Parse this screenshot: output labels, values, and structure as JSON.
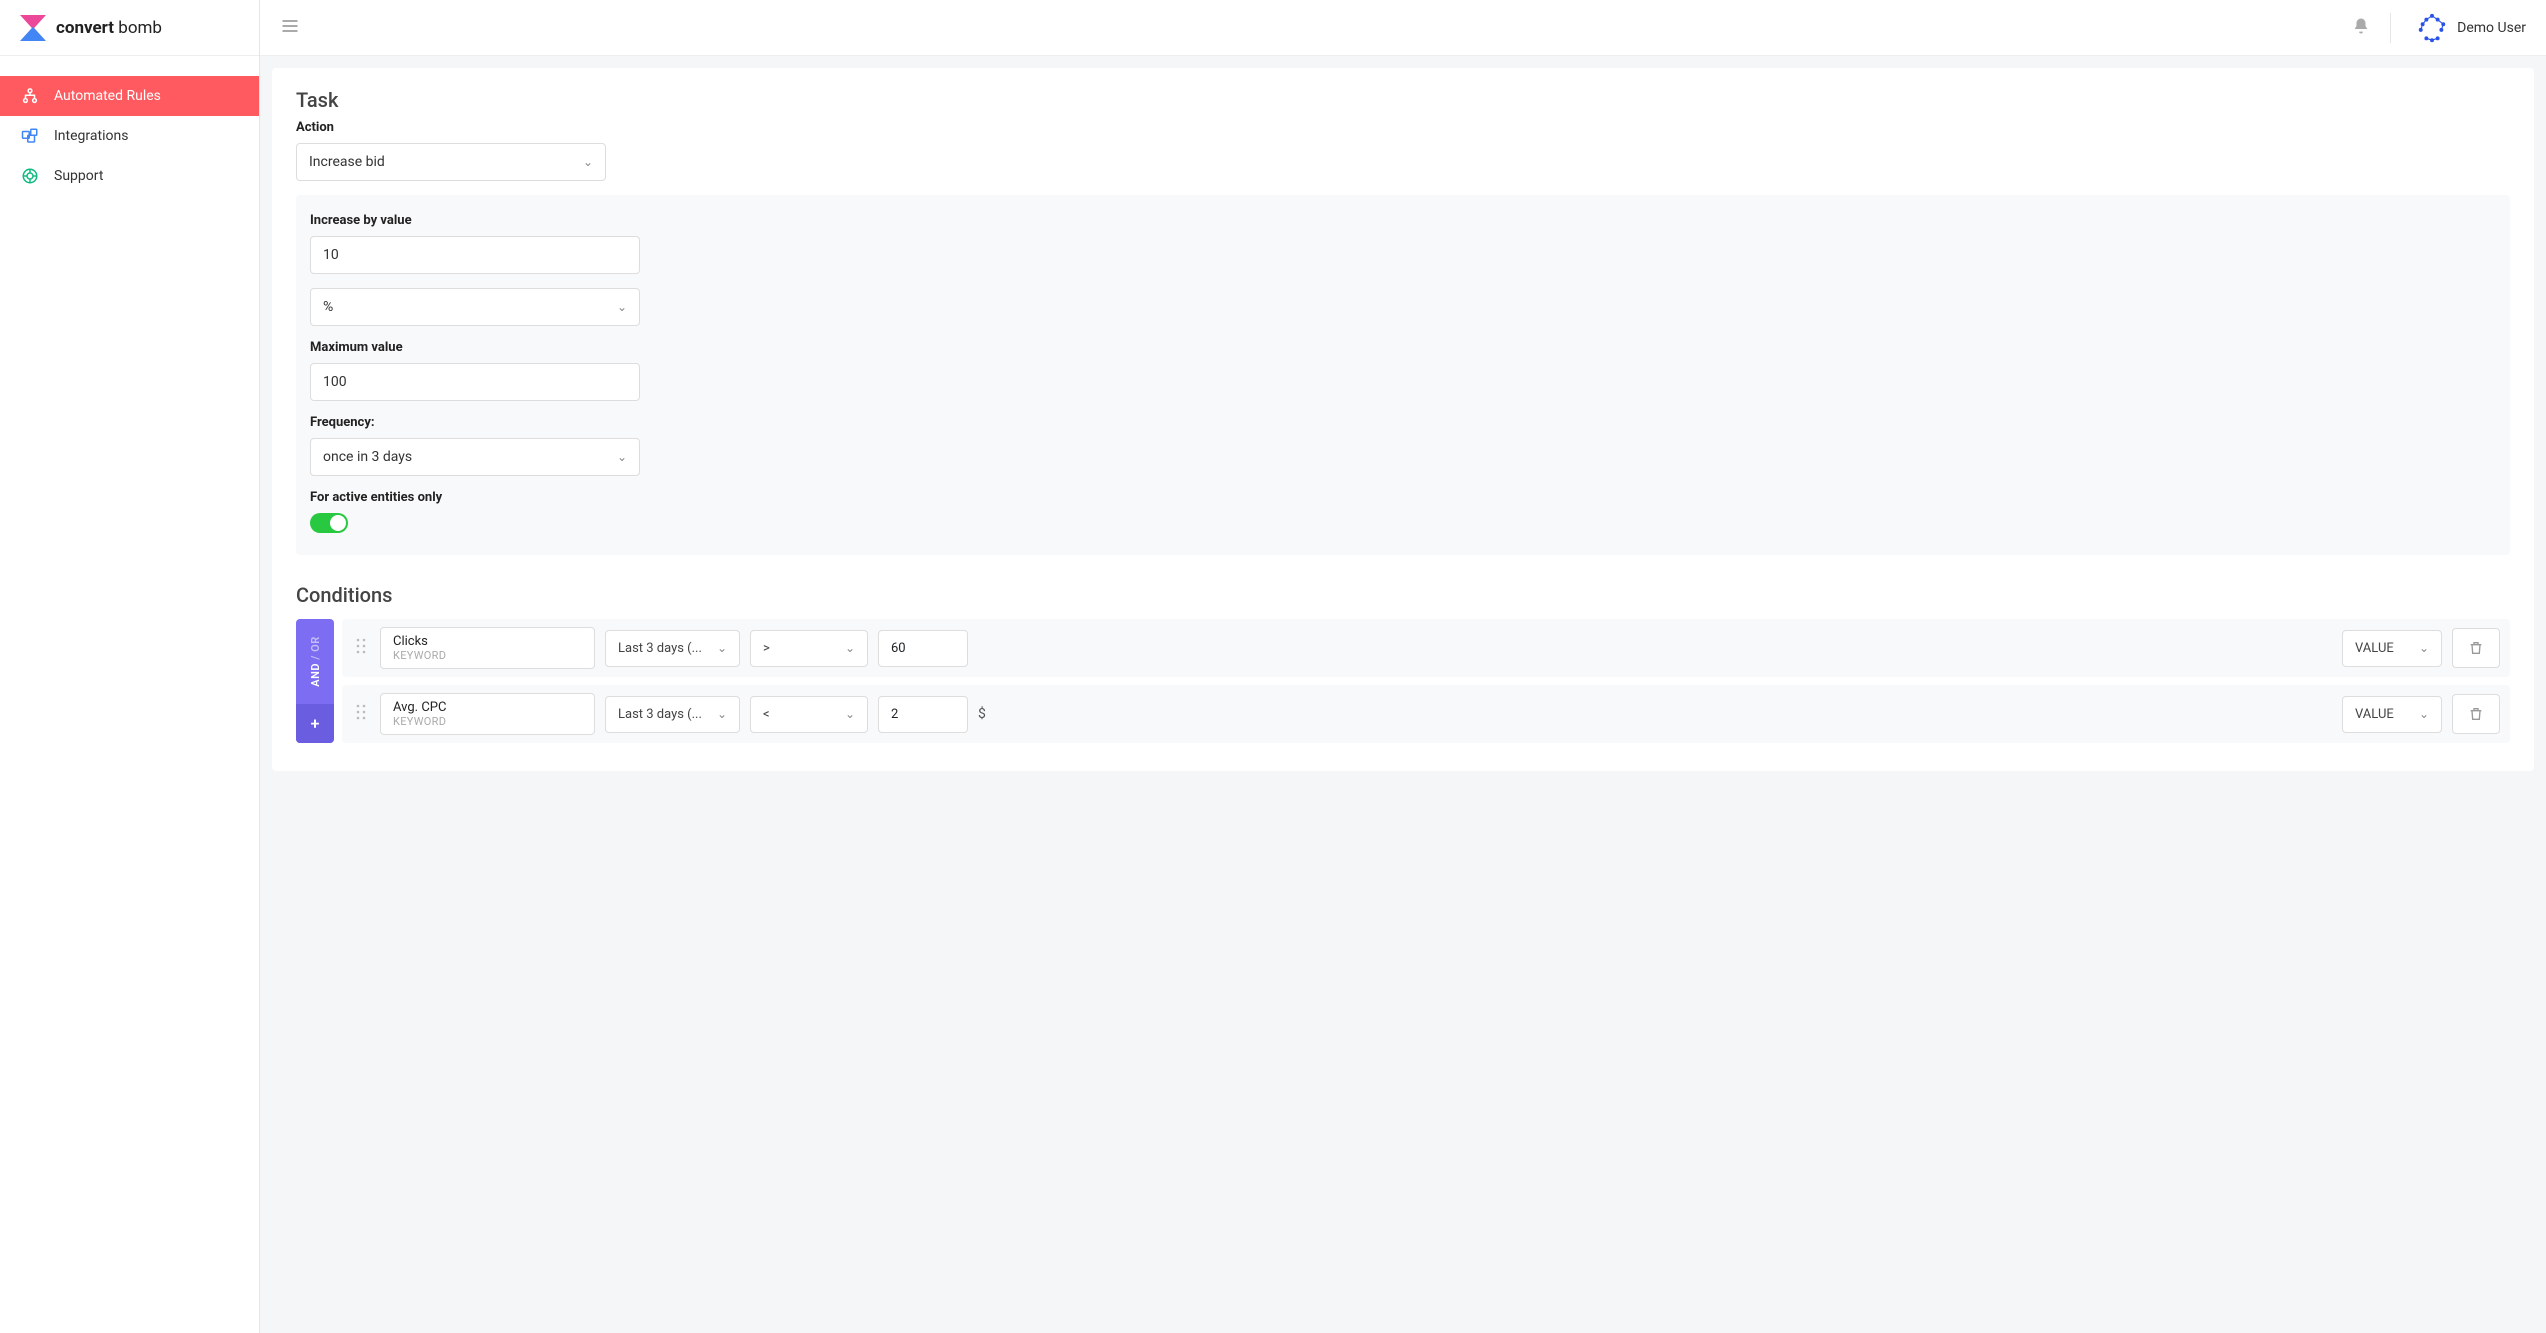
{
  "brand": {
    "bold": "convert",
    "light": " bomb"
  },
  "sidebar": {
    "items": [
      {
        "label": "Automated Rules"
      },
      {
        "label": "Integrations"
      },
      {
        "label": "Support"
      }
    ]
  },
  "topbar": {
    "user": "Demo User"
  },
  "task": {
    "title": "Task",
    "action_label": "Action",
    "action_value": "Increase bid",
    "increase_label": "Increase by value",
    "increase_value": "10",
    "unit_value": "%",
    "max_label": "Maximum value",
    "max_value": "100",
    "freq_label": "Frequency:",
    "freq_value": "once in 3 days",
    "active_label": "For active entities only"
  },
  "conditions": {
    "title": "Conditions",
    "operator": {
      "and": "AND",
      "sep": " / ",
      "or": "OR",
      "plus": "+"
    },
    "rows": [
      {
        "metric": "Clicks",
        "metric_sub": "KEYWORD",
        "period": "Last 3 days (...",
        "op": ">",
        "value": "60",
        "unit": "",
        "value_type": "VALUE"
      },
      {
        "metric": "Avg. CPC",
        "metric_sub": "KEYWORD",
        "period": "Last 3 days (...",
        "op": "<",
        "value": "2",
        "unit": "$",
        "value_type": "VALUE"
      }
    ]
  }
}
